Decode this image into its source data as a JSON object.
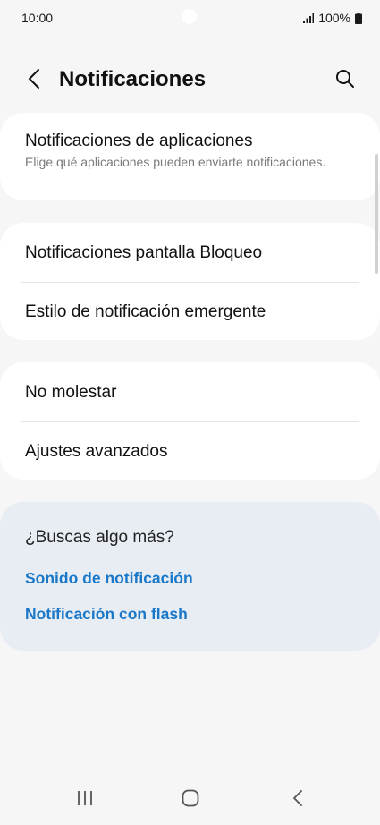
{
  "status_bar": {
    "time": "10:00",
    "battery": "100%"
  },
  "header": {
    "title": "Notificaciones",
    "back_icon": "chevron-left-icon",
    "search_icon": "search-icon"
  },
  "sections": {
    "app_notifications": {
      "title": "Notificaciones de aplicaciones",
      "subtitle": "Elige qué aplicaciones pueden enviarte notificaciones."
    },
    "lock_screen": {
      "title": "Notificaciones pantalla Bloqueo"
    },
    "popup_style": {
      "title": "Estilo de notificación emergente"
    },
    "do_not_disturb": {
      "title": "No molestar"
    },
    "advanced": {
      "title": "Ajustes avanzados"
    }
  },
  "looking_for_more": {
    "title": "¿Buscas algo más?",
    "links": [
      "Sonido de notificación",
      "Notificación con flash"
    ]
  },
  "nav_bar": {
    "recents_icon": "recents-icon",
    "home_icon": "home-icon",
    "back_icon": "back-icon"
  },
  "colors": {
    "background": "#f6f6f6",
    "card": "#ffffff",
    "suggestion_card": "#e8edf4",
    "link": "#1a78c8"
  }
}
